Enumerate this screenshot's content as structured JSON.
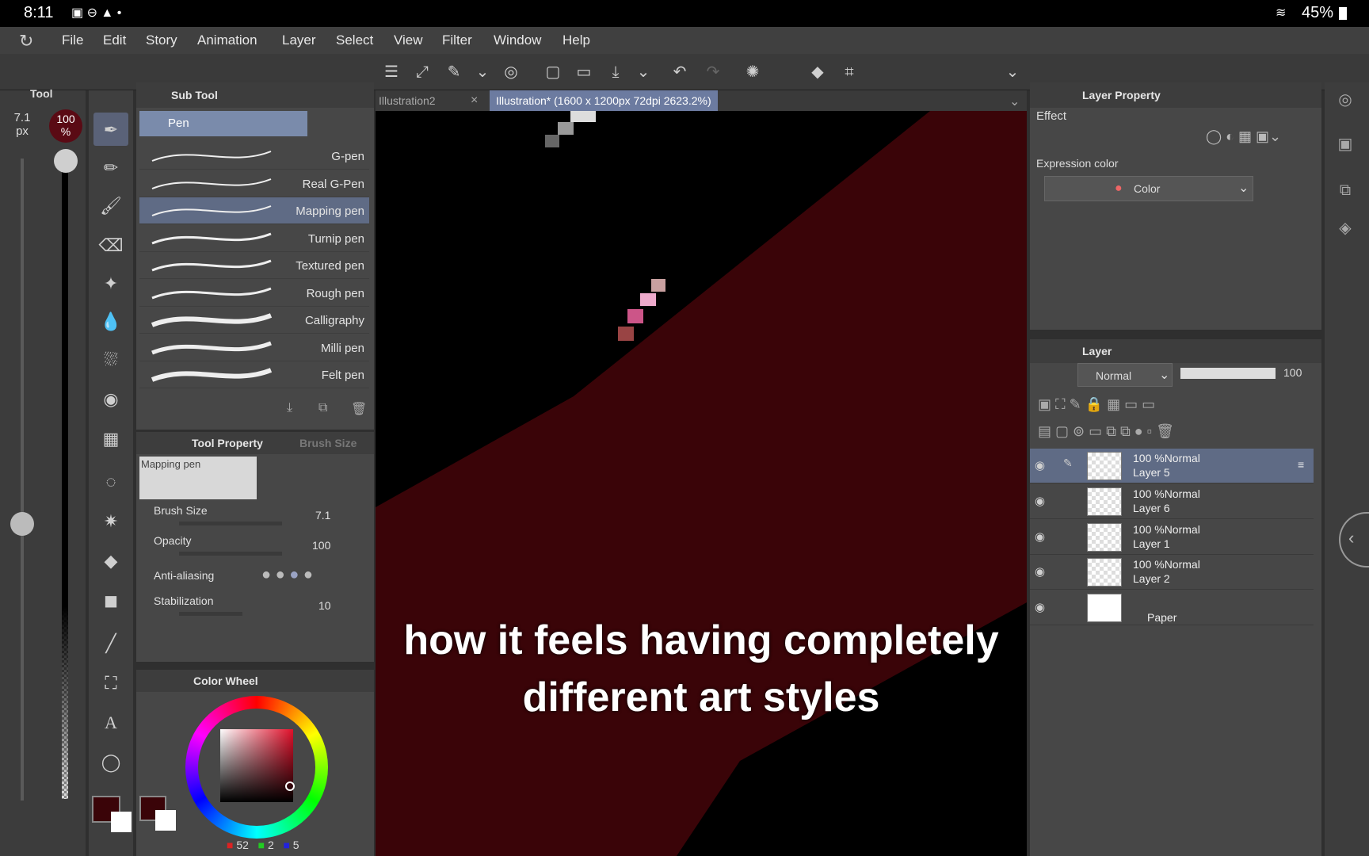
{
  "status": {
    "time": "8:11",
    "battery": "45%"
  },
  "menu": [
    "File",
    "Edit",
    "Story",
    "Animation",
    "Layer",
    "Select",
    "View",
    "Filter",
    "Window",
    "Help"
  ],
  "tabs": {
    "tab1": "Illustration2",
    "tab2": "Illustration* (1600 x 1200px 72dpi 2623.2%)"
  },
  "tool_panel": {
    "title": "Tool",
    "size_value": "7.1",
    "size_unit": "px",
    "opacity_value": "100",
    "opacity_unit": "%"
  },
  "subtool": {
    "title": "Sub Tool",
    "group": "Pen",
    "brushes": [
      "G-pen",
      "Real G-Pen",
      "Mapping pen",
      "Turnip pen",
      "Textured pen",
      "Rough pen",
      "Calligraphy",
      "Milli pen",
      "Felt pen"
    ],
    "selected": "Mapping pen"
  },
  "tool_property": {
    "title": "Tool Property",
    "tab2": "Brush Size",
    "preview_label": "Mapping pen",
    "brush_size_label": "Brush Size",
    "brush_size": "7.1",
    "opacity_label": "Opacity",
    "opacity": "100",
    "antialias_label": "Anti-aliasing",
    "stabilization_label": "Stabilization",
    "stabilization": "10"
  },
  "color_wheel": {
    "title": "Color Wheel",
    "r": "52",
    "g": "2",
    "b": "5",
    "main_color": "#3a0408"
  },
  "layer_property": {
    "title": "Layer Property",
    "effect_label": "Effect",
    "expression_label": "Expression color",
    "expression_value": "Color"
  },
  "layer_panel": {
    "title": "Layer",
    "blend": "Normal",
    "opacity": "100",
    "layers": [
      {
        "info": "100 %Normal",
        "name": "Layer 5"
      },
      {
        "info": "100 %Normal",
        "name": "Layer 6"
      },
      {
        "info": "100 %Normal",
        "name": "Layer 1"
      },
      {
        "info": "100 %Normal",
        "name": "Layer 2"
      },
      {
        "info": "",
        "name": "Paper"
      }
    ]
  },
  "caption": {
    "line1": "how it feels having completely",
    "line2": "different art styles"
  }
}
